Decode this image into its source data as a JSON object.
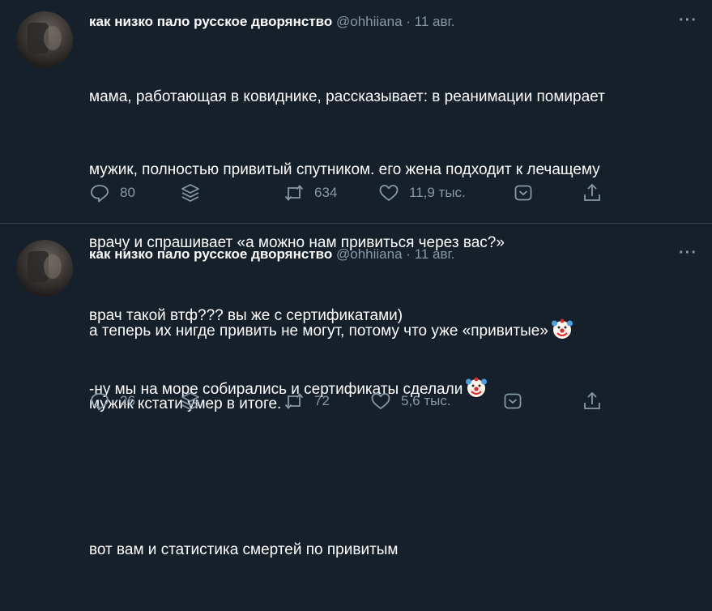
{
  "tweets": [
    {
      "author_name": "как низко пало русское дворянство",
      "handle": "@ohhiiana",
      "separator": "·",
      "date": "11 авг.",
      "more": "···",
      "lines": [
        "мама, работающая в ковиднике, рассказывает: в реанимации помирает",
        "мужик, полностью привитый спутником. его жена подходит к лечащему",
        "врачу и спрашивает «а можно нам привиться через вас?»",
        "врач такой втф??? вы же с сертификатами)",
        "-ну мы на море собирались и сертификаты сделали"
      ],
      "emoji_name": "clown-face-icon",
      "replies": "80",
      "retweets": "634",
      "likes": "11,9 тыс."
    },
    {
      "author_name": "как низко пало русское дворянство",
      "handle": "@ohhiiana",
      "separator": "·",
      "date": "11 авг.",
      "more": "···",
      "lines": [
        "а теперь их нигде привить не могут, потому что уже «привитые»",
        "мужик кстати умер в итоге.",
        "",
        "вот вам и статистика смертей по привитым"
      ],
      "emoji_name": "clown-face-icon",
      "replies": "26",
      "retweets": "72",
      "likes": "5,6 тыс."
    }
  ],
  "colors": {
    "background": "#15202b",
    "text": "#ffffff",
    "secondary": "#8899a6",
    "divider": "#38444d"
  }
}
